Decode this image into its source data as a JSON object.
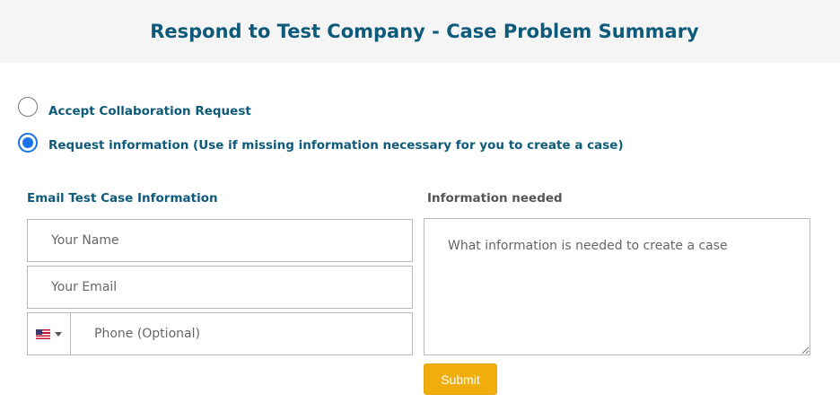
{
  "header": {
    "title": "Respond to Test Company - Case Problem Summary"
  },
  "options": [
    {
      "label": "Accept Collaboration Request",
      "checked": false
    },
    {
      "label": "Request information (Use if missing information necessary for you to create a case)",
      "checked": true
    }
  ],
  "left": {
    "title": "Email Test Case Information",
    "name_placeholder": "Your Name",
    "email_placeholder": "Your Email",
    "phone_placeholder": "Phone (Optional)",
    "country_flag_icon": "us-flag-icon"
  },
  "right": {
    "title": "Information needed",
    "textarea_placeholder": "What information is needed to create a case"
  },
  "submit_label": "Submit",
  "colors": {
    "title": "#0e5a7a",
    "header_bg": "#f5f5f5",
    "radio_selected": "#1a73e8",
    "submit_bg": "#f0ad0e"
  }
}
